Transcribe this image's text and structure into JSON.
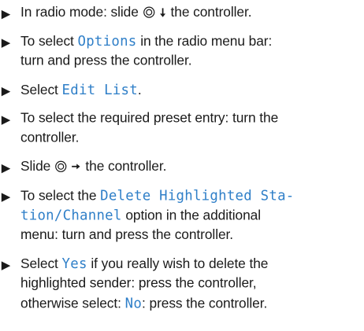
{
  "bullet_glyph": "▶",
  "accent_color": "#2f7fc8",
  "icons": {
    "controller": "controller-symbol-icon",
    "down": "down-arrow-icon",
    "right": "right-arrow-icon"
  },
  "steps": [
    {
      "lines": [
        {
          "t1": "In radio mode: slide ",
          "t2": " the controller."
        }
      ]
    },
    {
      "lines": [
        {
          "t1": "To select ",
          "hl": "Options",
          "t2": " in the radio menu bar:"
        },
        {
          "t1": "turn and press the controller."
        }
      ]
    },
    {
      "lines": [
        {
          "t1": "Select ",
          "hl": "Edit List",
          "t2": "."
        }
      ]
    },
    {
      "lines": [
        {
          "t1": "To select the required preset entry: turn the"
        },
        {
          "t1": "controller."
        }
      ]
    },
    {
      "lines": [
        {
          "t1": "Slide ",
          "t2": " the controller."
        }
      ]
    },
    {
      "lines": [
        {
          "t1": "To select the ",
          "hl": "Delete Highlighted Sta-"
        },
        {
          "hl": "tion/Channel",
          "t2": " option in the additional"
        },
        {
          "t1": "menu: turn and press the controller."
        }
      ]
    },
    {
      "lines": [
        {
          "t1": "Select ",
          "hl": "Yes",
          "t2": " if you really wish to delete the"
        },
        {
          "t1": "highlighted sender: press the controller,"
        },
        {
          "t1": "otherwise select: ",
          "hl": "No",
          "t2": ": press the controller."
        }
      ]
    }
  ]
}
